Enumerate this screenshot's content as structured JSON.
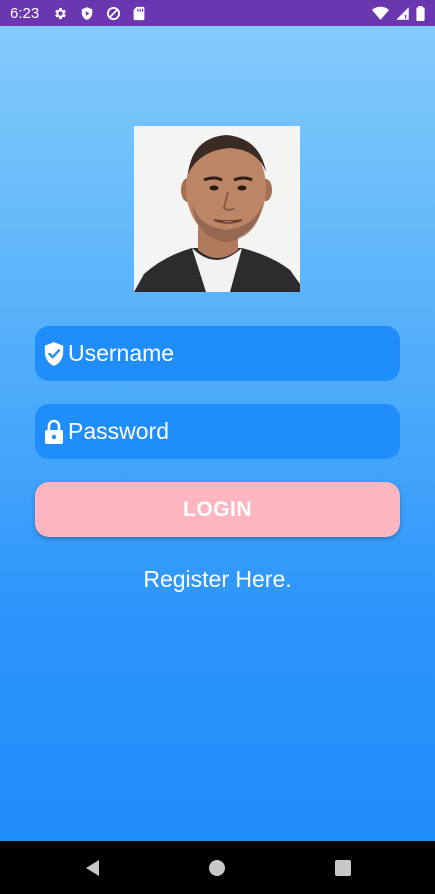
{
  "status_bar": {
    "time": "6:23",
    "left_icons": [
      "settings-icon",
      "shield-play-icon",
      "data-saver-icon",
      "sd-card-icon"
    ],
    "right_icons": [
      "wifi-icon",
      "cell-signal-icon",
      "battery-icon"
    ]
  },
  "profile": {
    "avatar": "profile-photo"
  },
  "form": {
    "username": {
      "placeholder": "Username",
      "value": "",
      "icon": "shield-check-icon"
    },
    "password": {
      "placeholder": "Password",
      "value": "",
      "icon": "lock-icon"
    },
    "login_label": "LOGIN",
    "register_label": "Register Here."
  },
  "colors": {
    "status_bar": "#6b37b0",
    "background_top": "#87cdfb",
    "background_bottom": "#1e8cfb",
    "field_background": "#1f8efa",
    "login_button": "#ffb6c1",
    "text": "#ffffff"
  },
  "nav_bar": {
    "buttons": [
      "back-icon",
      "home-icon",
      "recents-icon"
    ]
  }
}
